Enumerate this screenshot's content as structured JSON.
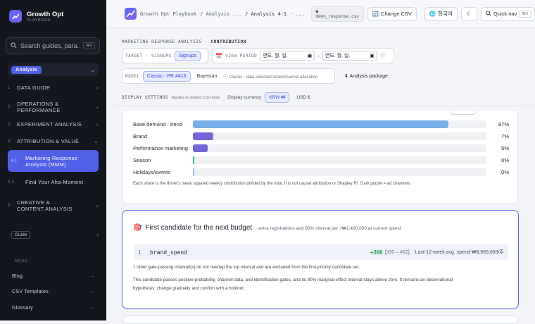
{
  "sidebar": {
    "brand": {
      "name": "Growth Opt",
      "sub": "PLAYBOOK"
    },
    "search": {
      "placeholder": "Search guides, para...",
      "shortcut": "⌘K"
    },
    "section_pill": "Analysis",
    "nav": [
      {
        "num": "1",
        "label": "DATA GUIDE"
      },
      {
        "num": "2",
        "label": "OPERATIONS & PERFORMANCE"
      },
      {
        "num": "3",
        "label": "EXPERIMENT ANALYSIS"
      },
      {
        "num": "4",
        "label": "ATTRIBUTION & VALUE"
      },
      {
        "num": "4-1",
        "label": "Marketing Response Analysis (MMM)"
      },
      {
        "num": "4-2",
        "label": "Find Your Aha-Moment"
      },
      {
        "num": "5",
        "label": "CREATIVE & CONTENT ANALYSIS"
      }
    ],
    "guide": "Guide",
    "more_label": "MORE",
    "links": [
      "Blog",
      "CSV Templates",
      "Glossary"
    ]
  },
  "topbar": {
    "crumbs": [
      "Growth Opt Playbook",
      "/ Analysis ...",
      "/ Analysis 4-1 · ..."
    ],
    "file": "demo_response.csv",
    "change_csv": "Change CSV",
    "lang": "한국어",
    "quick_nav": "Quick nav",
    "quick_key": "⌘K"
  },
  "controls": {
    "heading": "MARKETING RESPONSE ANALYSIS",
    "heading_sub": "CONTRIBUTION",
    "target_label": "TARGET · SIGNUPS",
    "target_value": "Signups",
    "period_label": "VIEW PERIOD",
    "date_placeholder": "연도. 월. 일.",
    "model_label": "MODEL",
    "model_classic": "Classic · PR #416",
    "model_bayes": "Bayesian",
    "model_note": "Classic · data-selected totals/channel allocation",
    "package": "Analysis package",
    "display_label": "DISPLAY SETTINGS",
    "display_note": "Applies to shared CSV tools",
    "currency_label": "Display currency",
    "currency_krw": "KRW ₩",
    "currency_usd": "USD $"
  },
  "contribution": {
    "rows": [
      {
        "name": "Base demand · trend",
        "pct": "87%",
        "share": 0.87,
        "color": "#7aaee8"
      },
      {
        "name": "Brand",
        "pct": "7%",
        "share": 0.07,
        "color": "#7466d8"
      },
      {
        "name": "Performance marketing",
        "pct": "5%",
        "share": 0.05,
        "color": "#7466d8"
      },
      {
        "name": "Season",
        "pct": "0%",
        "share": 0.0,
        "color": "#3dbf77"
      },
      {
        "name": "Holidays/events",
        "pct": "0%",
        "share": 0.0,
        "color": "#9fc3ec"
      }
    ],
    "note": "Each share is the driver's mean squared weekly contribution divided by the total. It is not causal attribution or Shapley R². Dark purple = ad channels."
  },
  "candidate": {
    "title": "First candidate for the next budget",
    "subtitle": "· extra registrations and 90% interval per +₩1,400,000 at current spend",
    "rank": "1",
    "channel": "brand_spend",
    "uplift": "+396",
    "interval": "[330 – 462]",
    "spend": "Last-12-week avg. spend ₩8,969,683/주",
    "line1": "1 other gate-passing channel(s) do not overlap the top interval and are excluded from the first-priority candidate set.",
    "line2": "This candidate passes positive-probability, channel-data, and identification gates, and its 90% marginal-effect interval stays above zero. It remains an observational hypothesis; change gradually and confirm with a holdout."
  }
}
